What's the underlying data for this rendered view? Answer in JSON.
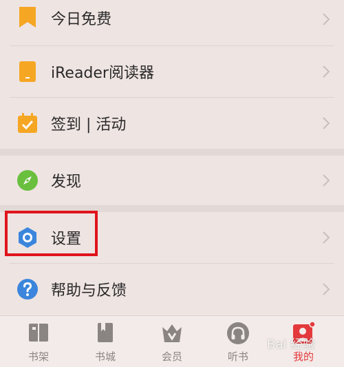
{
  "menu": {
    "items": [
      {
        "label": "今日免费",
        "icon": "bookmark-icon"
      },
      {
        "label": "iReader阅读器",
        "icon": "ereader-device-icon"
      },
      {
        "label": "签到 | 活动",
        "icon": "calendar-check-icon"
      },
      {
        "label": "发现",
        "icon": "compass-icon"
      },
      {
        "label": "设置",
        "icon": "settings-hex-icon"
      },
      {
        "label": "帮助与反馈",
        "icon": "help-icon"
      }
    ]
  },
  "tabbar": {
    "tabs": [
      {
        "label": "书架",
        "icon": "bookshelf-icon"
      },
      {
        "label": "书城",
        "icon": "bookstore-icon"
      },
      {
        "label": "会员",
        "icon": "vip-crown-icon"
      },
      {
        "label": "听书",
        "icon": "headphones-icon"
      },
      {
        "label": "我的",
        "icon": "my-profile-icon"
      }
    ],
    "active": "我的"
  },
  "watermark": "Bai 经验",
  "colors": {
    "background": "#eee4e2",
    "highlight": "#e0141c",
    "accent": "#e4393c",
    "icon_orange": "#f5a623",
    "icon_green": "#6abf3f",
    "icon_blue": "#3b86dc"
  }
}
